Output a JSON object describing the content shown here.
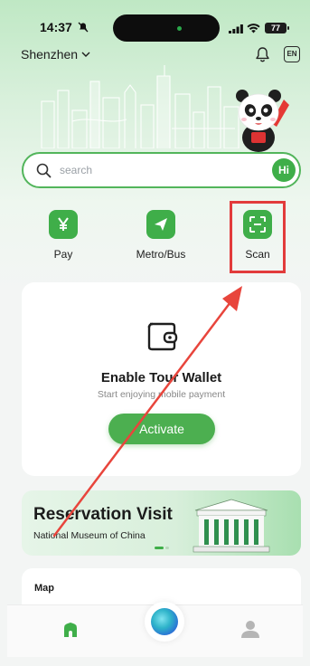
{
  "status_bar": {
    "time": "14:37",
    "battery": "77"
  },
  "header": {
    "city": "Shenzhen",
    "language": "EN"
  },
  "search": {
    "placeholder": "search",
    "assistant_label": "Hi"
  },
  "quick_actions": [
    {
      "label": "Pay",
      "icon": "yen-icon"
    },
    {
      "label": "Metro/Bus",
      "icon": "paper-plane-icon"
    },
    {
      "label": "Scan",
      "icon": "scan-icon"
    }
  ],
  "wallet": {
    "title": "Enable Tour Wallet",
    "subtitle": "Start enjoying mobile payment",
    "button_label": "Activate"
  },
  "reservation": {
    "title": "Reservation Visit",
    "subtitle": "National Museum of China"
  },
  "map": {
    "label": "Map"
  },
  "tabs": {
    "home": "home-icon",
    "assistant": "ai-orb-icon",
    "profile": "profile-icon"
  },
  "colors": {
    "brand_green": "#3fae49",
    "highlight_red": "#e23b3b"
  }
}
